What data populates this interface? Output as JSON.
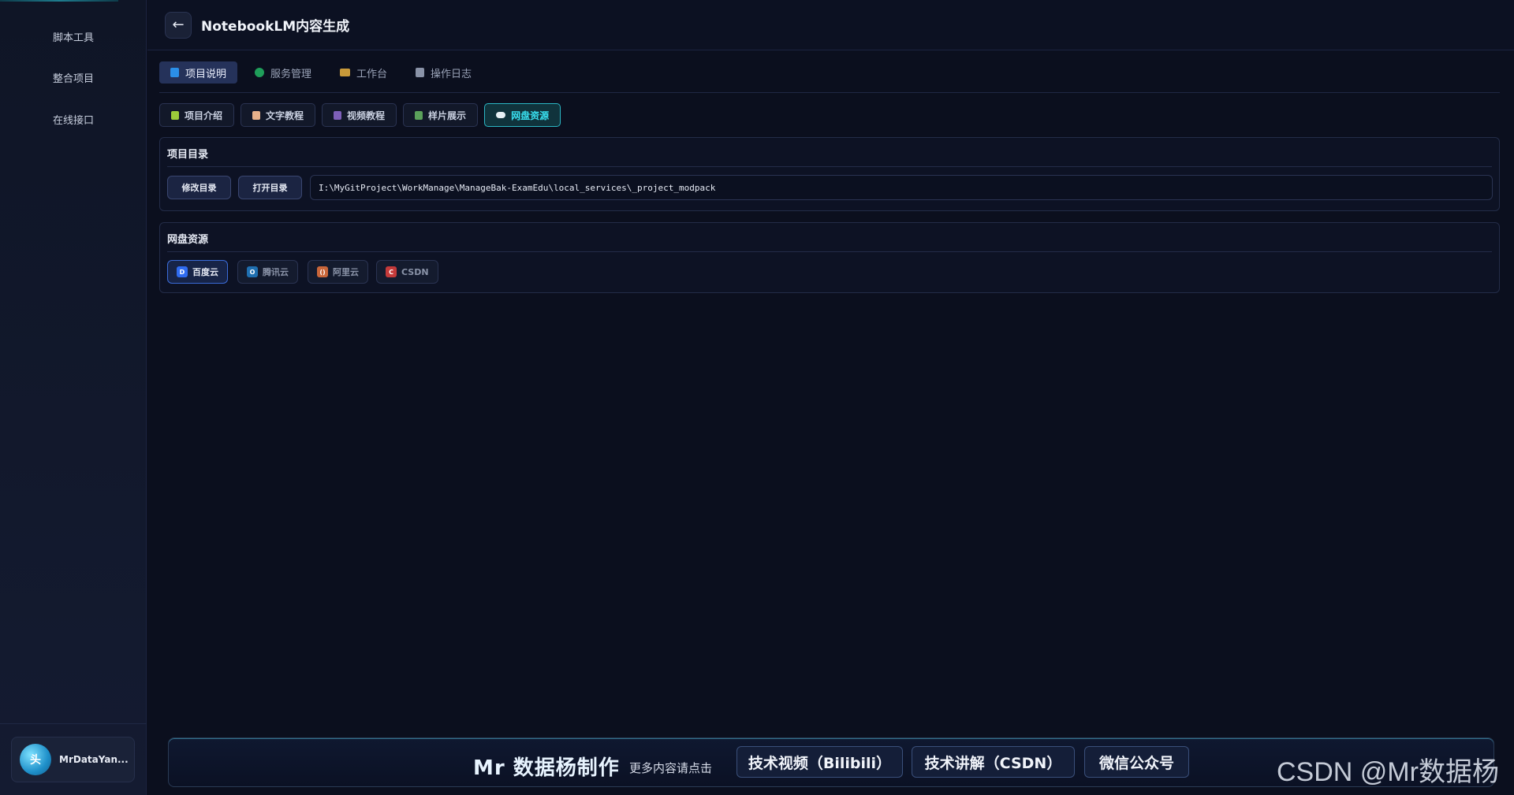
{
  "sidebar": {
    "items": [
      {
        "label": "脚本工具"
      },
      {
        "label": "整合项目"
      },
      {
        "label": "在线接口"
      }
    ],
    "user": {
      "avatar_text": "头",
      "name": "MrDataYan..."
    }
  },
  "header": {
    "back_icon": "←",
    "title": "NotebookLM内容生成"
  },
  "main_tabs": [
    {
      "label": "项目说明",
      "icon": "book-icon",
      "color": "#2b8fe8",
      "active": true
    },
    {
      "label": "服务管理",
      "icon": "status-dot-icon",
      "color": "#1f9e5a",
      "active": false
    },
    {
      "label": "工作台",
      "icon": "briefcase-icon",
      "color": "#c99a3a",
      "active": false
    },
    {
      "label": "操作日志",
      "icon": "log-icon",
      "color": "#8a93a8",
      "active": false
    }
  ],
  "sub_tabs": [
    {
      "label": "项目介绍",
      "icon": "puzzle-icon",
      "color": "#9ccc3a",
      "active": false
    },
    {
      "label": "文字教程",
      "icon": "document-icon",
      "color": "#e7b08a",
      "active": false
    },
    {
      "label": "视频教程",
      "icon": "film-icon",
      "color": "#7d5fb8",
      "active": false
    },
    {
      "label": "样片展示",
      "icon": "image-icon",
      "color": "#5aa05a",
      "active": false
    },
    {
      "label": "网盘资源",
      "icon": "cloud-icon",
      "color": "#e6f0f5",
      "active": true
    }
  ],
  "project_dir": {
    "title": "项目目录",
    "modify_label": "修改目录",
    "open_label": "打开目录",
    "path": "I:\\MyGitProject\\WorkManage\\ManageBak-ExamEdu\\local_services\\_project_modpack"
  },
  "cloud": {
    "title": "网盘资源",
    "providers": [
      {
        "label": "百度云",
        "icon": "baidu-icon",
        "glyph": "D",
        "color": "#2f6bf0",
        "active": true
      },
      {
        "label": "腾讯云",
        "icon": "tencent-icon",
        "glyph": "O",
        "color": "#1f6fb0",
        "active": false
      },
      {
        "label": "阿里云",
        "icon": "aliyun-icon",
        "glyph": "()",
        "color": "#c9663a",
        "active": false
      },
      {
        "label": "CSDN",
        "icon": "csdn-icon",
        "glyph": "C",
        "color": "#c43a3a",
        "active": false
      }
    ]
  },
  "footer": {
    "brand": "Mr 数据杨制作",
    "subtitle": "更多内容请点击",
    "links": [
      {
        "label": "技术视频（Bilibili）"
      },
      {
        "label": "技术讲解（CSDN）"
      },
      {
        "label": "微信公众号"
      }
    ]
  },
  "watermark": "CSDN @Mr数据杨"
}
